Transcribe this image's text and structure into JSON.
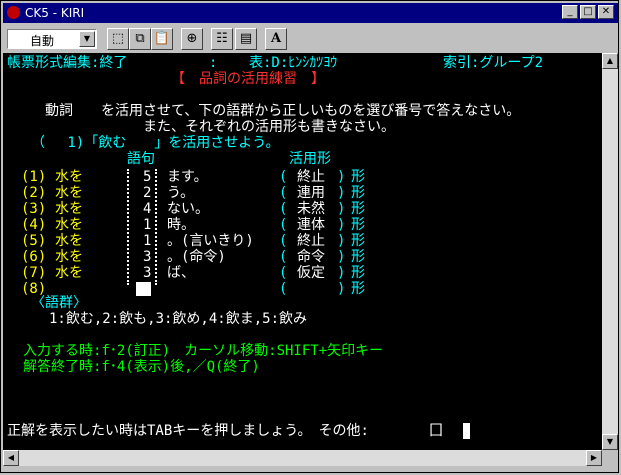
{
  "window": {
    "title": "CK5 - KIRI"
  },
  "toolbar": {
    "mode_value": "自動",
    "font_tool_label": "A"
  },
  "header": {
    "left": "帳票形式編集:終了",
    "colon": ":",
    "table": "表:D:ﾋﾝｼｶﾂﾖｳ",
    "index": "索引:グループ2"
  },
  "quiz": {
    "title": "【　品詞の活用練習　】",
    "instruction1": "動詞　　を活用させて、下の語群から正しいものを選び番号で答えなさい。",
    "instruction2": "また、それぞれの活用形も書きなさい。",
    "prompt": "（　 1)「飲む　　」を活用させよう。",
    "col_word": "語句",
    "col_form": "活用形",
    "rows": [
      {
        "num": "(1)",
        "subject": "水を",
        "answer": "5",
        "ending": "ます。",
        "form": "終止",
        "suffix": "形"
      },
      {
        "num": "(2)",
        "subject": "水を",
        "answer": "2",
        "ending": "う。",
        "form": "連用",
        "suffix": "形"
      },
      {
        "num": "(3)",
        "subject": "水を",
        "answer": "4",
        "ending": "ない。",
        "form": "未然",
        "suffix": "形"
      },
      {
        "num": "(4)",
        "subject": "水を",
        "answer": "1",
        "ending": "時。",
        "form": "連体",
        "suffix": "形"
      },
      {
        "num": "(5)",
        "subject": "水を",
        "answer": "1",
        "ending": "。(言いきり)",
        "form": "終止",
        "suffix": "形"
      },
      {
        "num": "(6)",
        "subject": "水を",
        "answer": "3",
        "ending": "。(命令)",
        "form": "命令",
        "suffix": "形"
      },
      {
        "num": "(7)",
        "subject": "水を",
        "answer": "3",
        "ending": "ば、",
        "form": "仮定",
        "suffix": "形"
      },
      {
        "num": "(8)",
        "subject": "",
        "answer": "",
        "ending": "",
        "form": "",
        "suffix": "形"
      }
    ],
    "group_label": "〈語群〉",
    "group_items": "1:飲む,2:飲も,3:飲め,4:飲ま,5:飲み",
    "help1": "入力する時:f･2(訂正)　カーソル移動:SHIFT+矢印キー",
    "help2": "解答終了時:f･4(表示)後,／Q(終了)",
    "status": "正解を表示したい時はTABキーを押しましょう。　その他:",
    "status_glyph": "囗"
  }
}
